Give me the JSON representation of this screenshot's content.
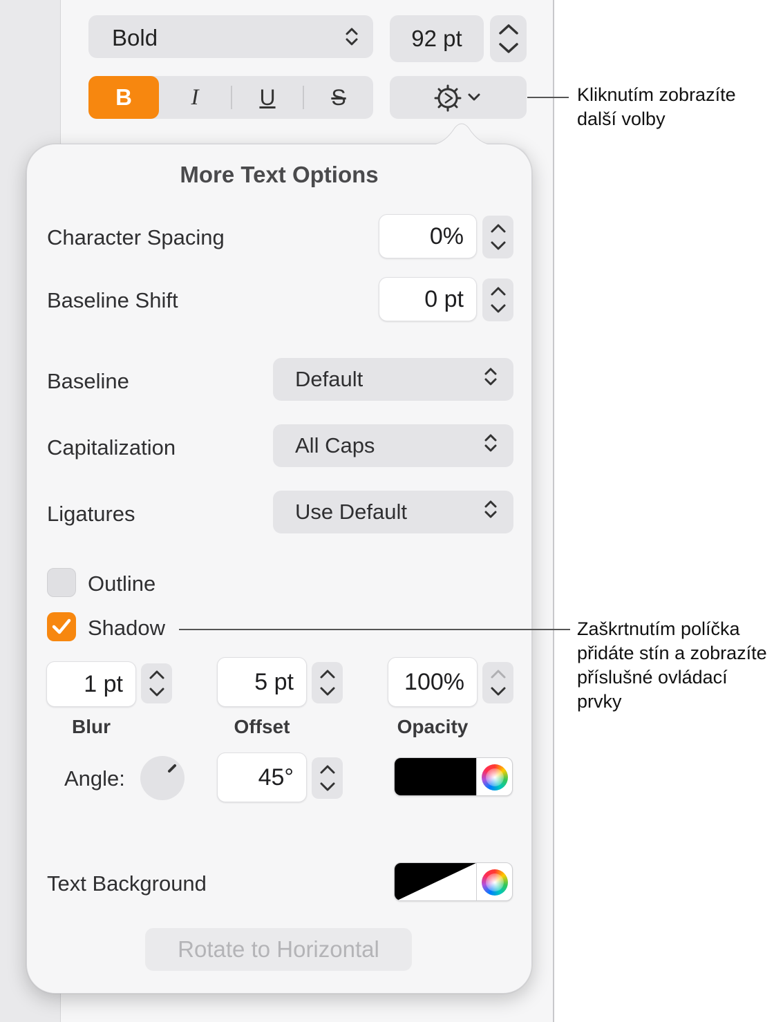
{
  "toolbar": {
    "font_style": "Bold",
    "font_size": "92 pt",
    "bold_label": "B",
    "italic_label": "I",
    "underline_label": "U",
    "strike_label": "S"
  },
  "popover": {
    "title": "More Text Options",
    "character_spacing": {
      "label": "Character Spacing",
      "value": "0%"
    },
    "baseline_shift": {
      "label": "Baseline Shift",
      "value": "0 pt"
    },
    "baseline": {
      "label": "Baseline",
      "value": "Default"
    },
    "capitalization": {
      "label": "Capitalization",
      "value": "All Caps"
    },
    "ligatures": {
      "label": "Ligatures",
      "value": "Use Default"
    },
    "outline": {
      "label": "Outline",
      "checked": false
    },
    "shadow": {
      "label": "Shadow",
      "checked": true,
      "blur": {
        "label": "Blur",
        "value": "1 pt"
      },
      "offset": {
        "label": "Offset",
        "value": "5 pt"
      },
      "opacity": {
        "label": "Opacity",
        "value": "100%"
      },
      "angle": {
        "label": "Angle:",
        "value": "45°"
      },
      "color": "#000000"
    },
    "text_background": {
      "label": "Text Background"
    },
    "rotate_button": "Rotate to Horizontal"
  },
  "callouts": {
    "gear": "Kliknutím zobrazíte další volby",
    "shadow": "Zaškrtnutím políčka přidáte stín a zobrazíte příslušné ovládací prvky"
  },
  "colors": {
    "accent": "#f7870f",
    "panel": "#f6f6f7",
    "control": "#e4e4e7"
  },
  "icons": [
    "chevron-updown-icon",
    "gear-icon",
    "chevron-down-icon",
    "checkmark-icon",
    "color-wheel-icon",
    "angle-dial-icon"
  ]
}
